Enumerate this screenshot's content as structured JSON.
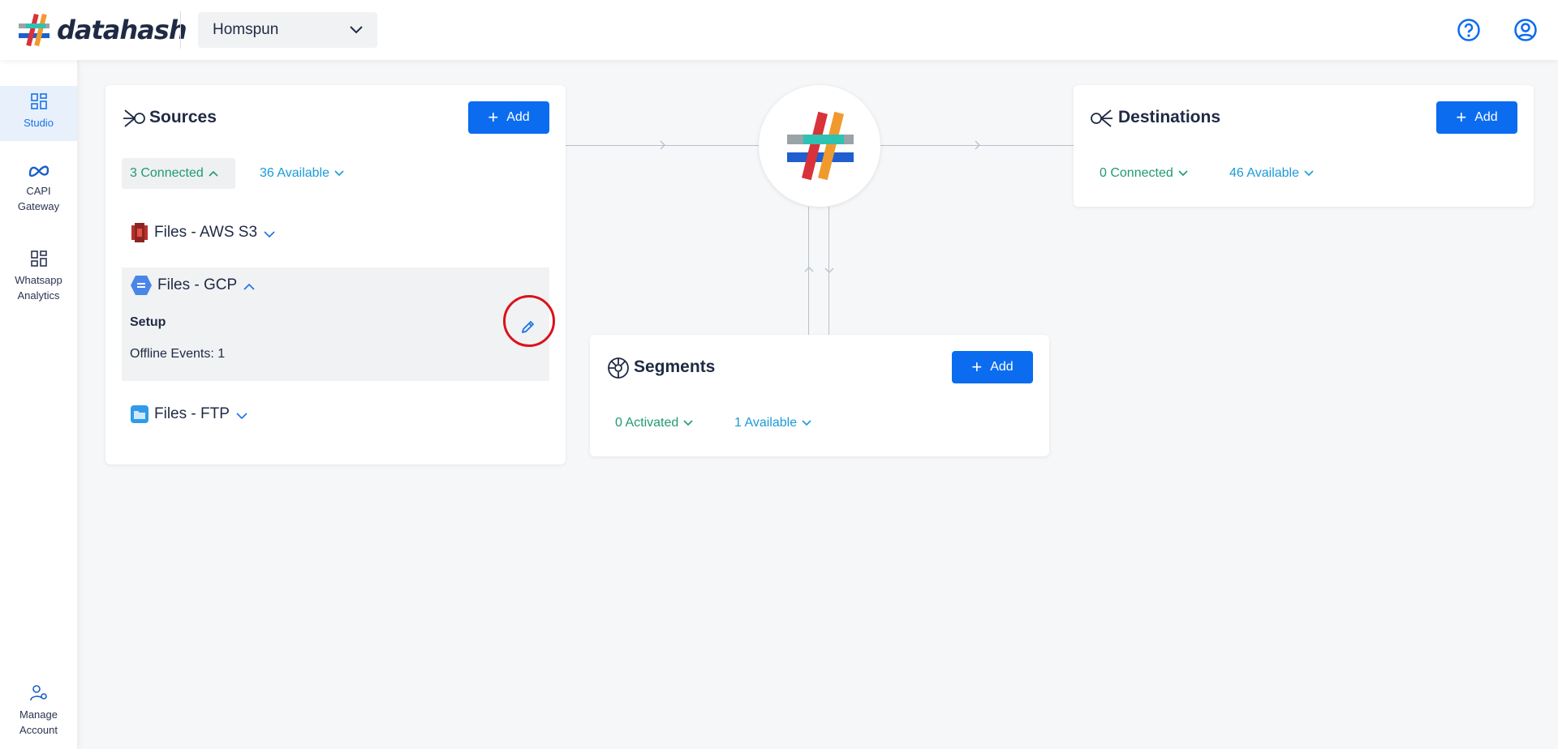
{
  "header": {
    "logo_text": "datahash",
    "workspace": "Homspun",
    "help_icon": "help-circle-icon",
    "account_icon": "user-circle-icon"
  },
  "sidebar": {
    "items": [
      {
        "label": "Studio",
        "icon": "dashboard-icon",
        "active": true
      },
      {
        "label": "CAPI\nGateway",
        "icon": "meta-icon",
        "active": false
      },
      {
        "label": "Whatsapp\nAnalytics",
        "icon": "dashboard-icon",
        "active": false
      },
      {
        "label": "Manage\nAccount",
        "icon": "user-settings-icon",
        "active": false
      }
    ]
  },
  "sources": {
    "title": "Sources",
    "add_label": "Add",
    "connected": "3 Connected",
    "available": "36 Available",
    "items": [
      {
        "label": "Files - AWS S3",
        "icon": "aws-s3-icon",
        "expanded": false
      },
      {
        "label": "Files - GCP",
        "icon": "gcp-icon",
        "expanded": true,
        "setup_label": "Setup",
        "offline_events": "Offline Events: 1"
      },
      {
        "label": "Files - FTP",
        "icon": "folder-icon",
        "expanded": false
      }
    ]
  },
  "destinations": {
    "title": "Destinations",
    "add_label": "Add",
    "connected": "0 Connected",
    "available": "46 Available"
  },
  "segments": {
    "title": "Segments",
    "add_label": "Add",
    "activated": "0 Activated",
    "available": "1 Available"
  },
  "colors": {
    "primary": "#0b6cf0",
    "green_text": "#1f9b6e",
    "blue_text": "#1a9bd7",
    "highlight": "#d8141b"
  }
}
